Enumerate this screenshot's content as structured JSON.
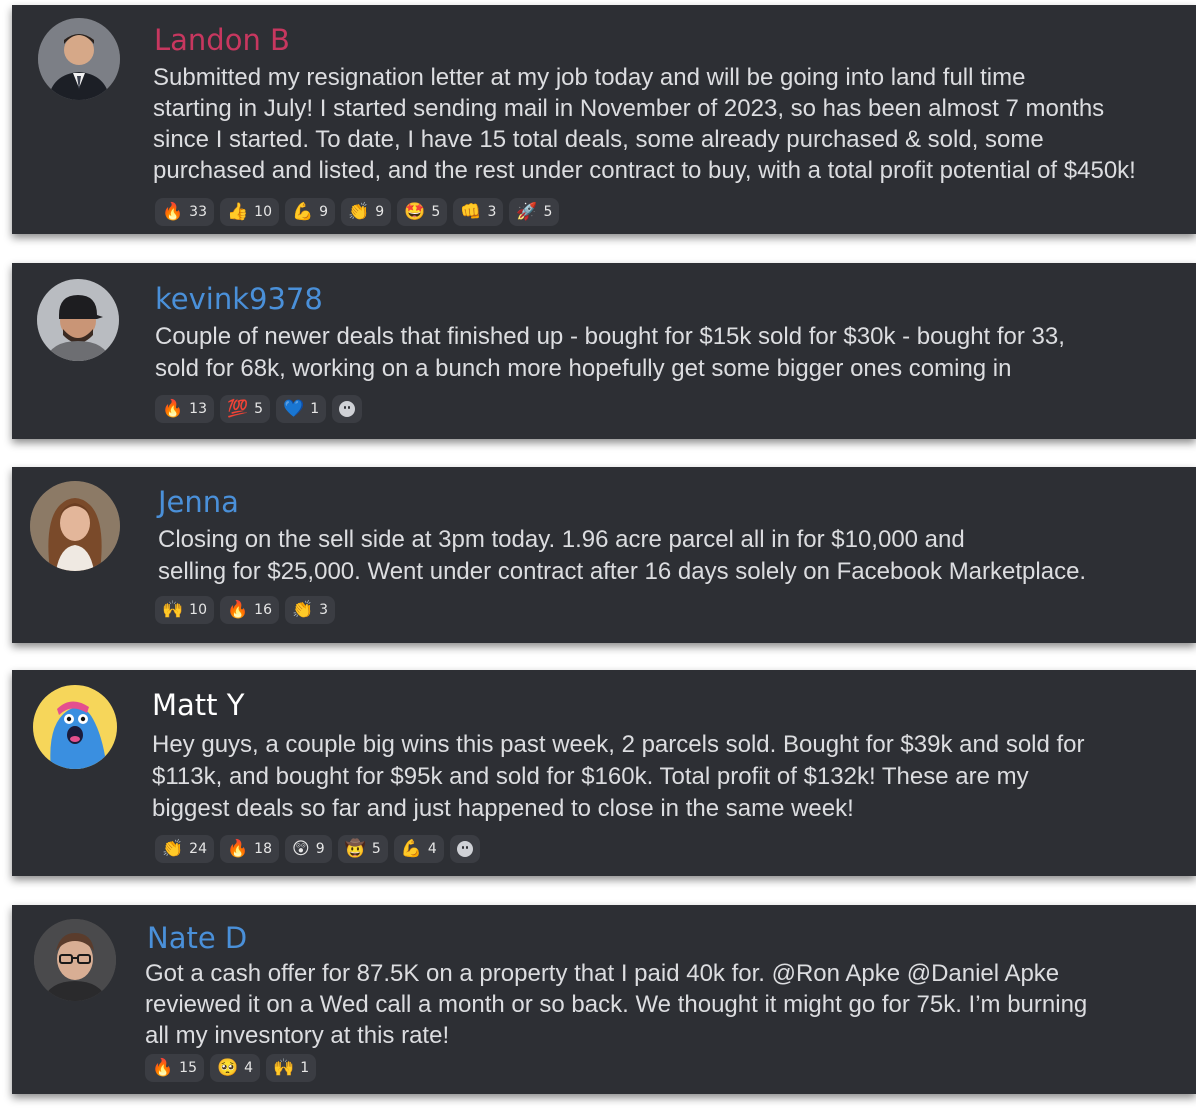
{
  "colors": {
    "card_bg": "#2d2f34",
    "pill_bg": "#3b3d43",
    "text": "#dcdde0",
    "pink": "#c7375f",
    "blue": "#4a90d9",
    "white": "#ffffff"
  },
  "posts": [
    {
      "name": "Landon B",
      "name_color": "#c7375f",
      "avatar": "man-in-suit-avatar",
      "text": "Submitted my resignation letter at my job today and will be going into land full time\nstarting in July! I started sending mail in November of 2023, so has been almost 7 months\nsince I started. To date, I have 15 total deals, some already purchased & sold, some\npurchased and listed, and the rest under contract to buy, with a total profit potential of $450k!",
      "reactions": [
        {
          "emoji": "🔥",
          "count": "33"
        },
        {
          "emoji": "👍",
          "count": "10"
        },
        {
          "emoji": "💪",
          "count": "9"
        },
        {
          "emoji": "👏",
          "count": "9"
        },
        {
          "emoji": "🤩",
          "count": "5"
        },
        {
          "emoji": "👊",
          "count": "3"
        },
        {
          "emoji": "🚀",
          "count": "5"
        }
      ]
    },
    {
      "name": "kevink9378",
      "name_color": "#4a90d9",
      "avatar": "man-with-cap-avatar",
      "text": "Couple of newer deals that finished up - bought for $15k sold for $30k - bought for 33,\nsold for 68k, working on a bunch more hopefully get some bigger ones coming in",
      "reactions": [
        {
          "emoji": "🔥",
          "count": "13"
        },
        {
          "emoji": "💯",
          "count": "5"
        },
        {
          "emoji": "💙",
          "count": "1"
        }
      ],
      "add_reaction": true
    },
    {
      "name": "Jenna",
      "name_color": "#4a90d9",
      "avatar": "woman-portrait-avatar",
      "text": "Closing on the sell side at 3pm today. 1.96 acre parcel all in for $10,000 and\nselling for $25,000. Went under contract after 16 days solely on Facebook Marketplace.",
      "reactions": [
        {
          "emoji": "🙌",
          "count": "10"
        },
        {
          "emoji": "🔥",
          "count": "16"
        },
        {
          "emoji": "👏",
          "count": "3"
        }
      ]
    },
    {
      "name": "Matt Y",
      "name_color": "#ffffff",
      "avatar": "blue-cartoon-avatar",
      "text": "Hey guys, a couple big wins this past week, 2 parcels sold. Bought for $39k and sold for\n$113k, and bought for $95k and sold for $160k. Total profit of $132k! These are my\nbiggest deals so far and just happened to close in the same week!",
      "reactions": [
        {
          "emoji": "👏",
          "count": "24"
        },
        {
          "emoji": "🔥",
          "count": "18"
        },
        {
          "emoji": "😲",
          "count": "9"
        },
        {
          "emoji": "🤠",
          "count": "5"
        },
        {
          "emoji": "💪",
          "count": "4"
        }
      ],
      "add_reaction": true
    },
    {
      "name": "Nate D",
      "name_color": "#4a90d9",
      "avatar": "man-with-glasses-avatar",
      "text": "Got a cash offer for 87.5K on a property that I paid 40k for. @Ron Apke @Daniel Apke\nreviewed it on a Wed call a month or so back. We thought it might go for 75k. I’m burning\nall my invesntory at this rate!",
      "reactions": [
        {
          "emoji": "🔥",
          "count": "15"
        },
        {
          "emoji": "🥺",
          "count": "4"
        },
        {
          "emoji": "🙌",
          "count": "1"
        }
      ]
    }
  ]
}
